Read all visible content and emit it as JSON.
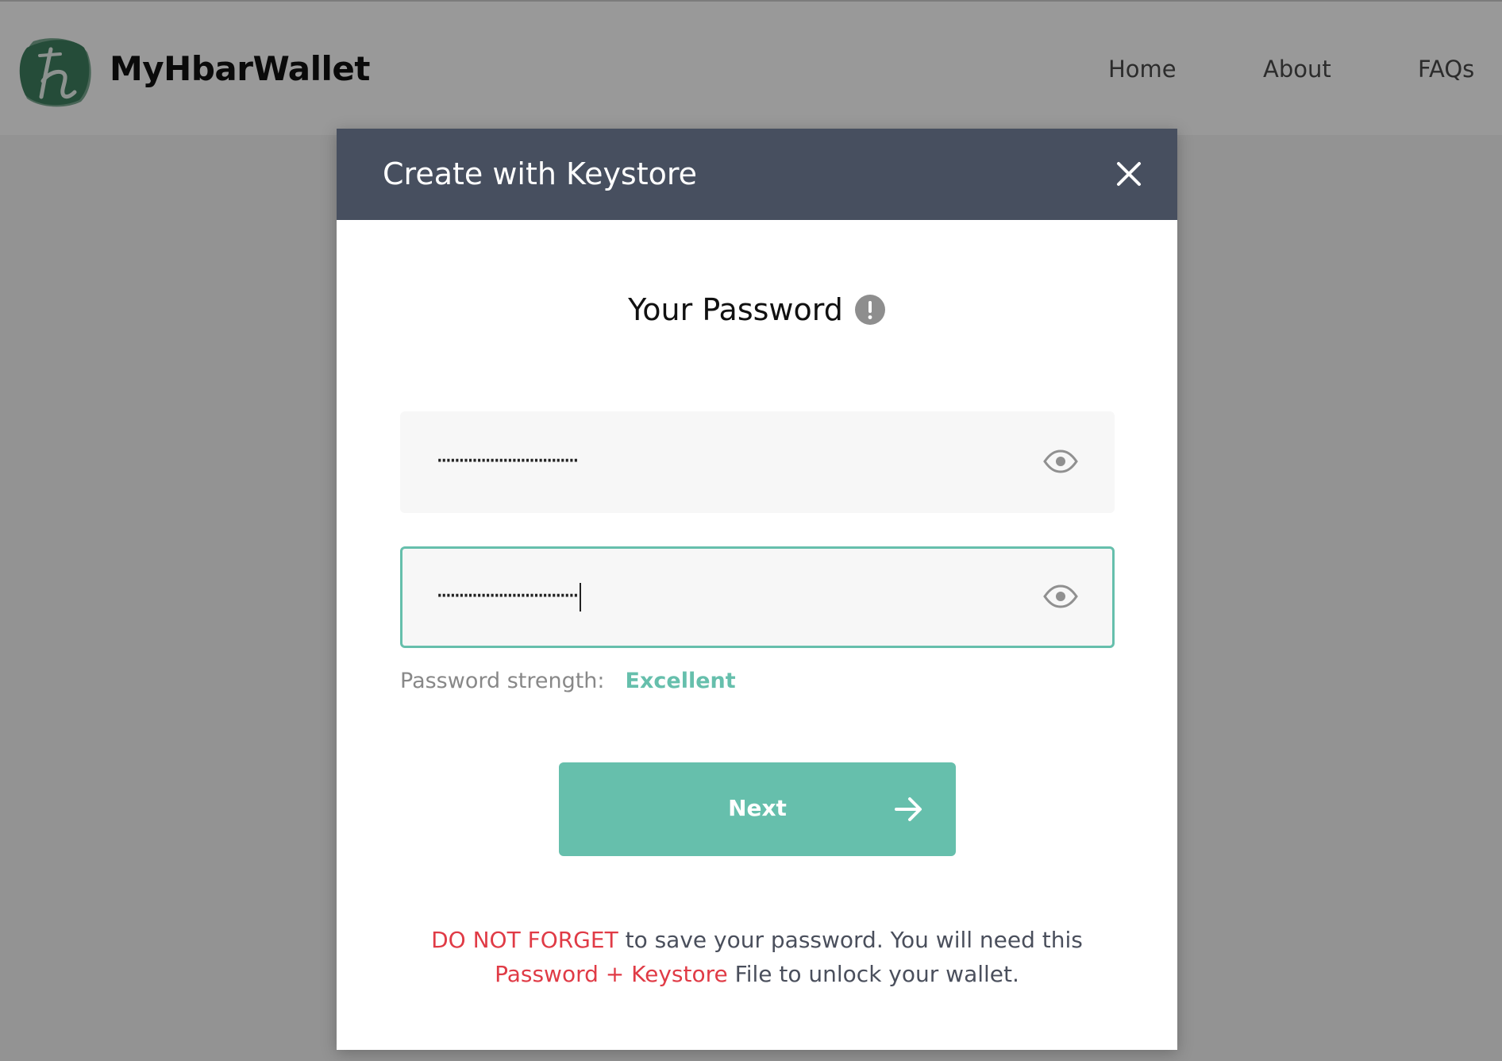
{
  "app": {
    "brand": "MyHbarWallet",
    "logo_icon": "hbar-logo-icon",
    "brand_color": "#3f7f5f"
  },
  "nav": {
    "items": [
      {
        "label": "Home"
      },
      {
        "label": "About"
      },
      {
        "label": "FAQs"
      }
    ]
  },
  "modal": {
    "title": "Create with Keystore",
    "close_icon": "close-icon",
    "header_color": "#474f5f",
    "section_title": "Your Password",
    "info_icon": "exclamation-icon",
    "password_field": {
      "value": "································",
      "icon": "eye-icon"
    },
    "confirm_field": {
      "value": "································",
      "icon": "eye-icon",
      "focused": true,
      "focus_color": "#66bfac"
    },
    "strength": {
      "label": "Password strength:",
      "value": "Excellent",
      "color": "#66bfac"
    },
    "next_button": {
      "label": "Next",
      "icon": "arrow-right-icon",
      "color": "#66bfac"
    },
    "warning": {
      "emphasis1": "DO NOT FORGET",
      "text1": " to save your password. You will need this",
      "emphasis2": "Password + Keystore",
      "text2": " File to unlock your wallet.",
      "emphasis_color": "#e03b46"
    }
  }
}
